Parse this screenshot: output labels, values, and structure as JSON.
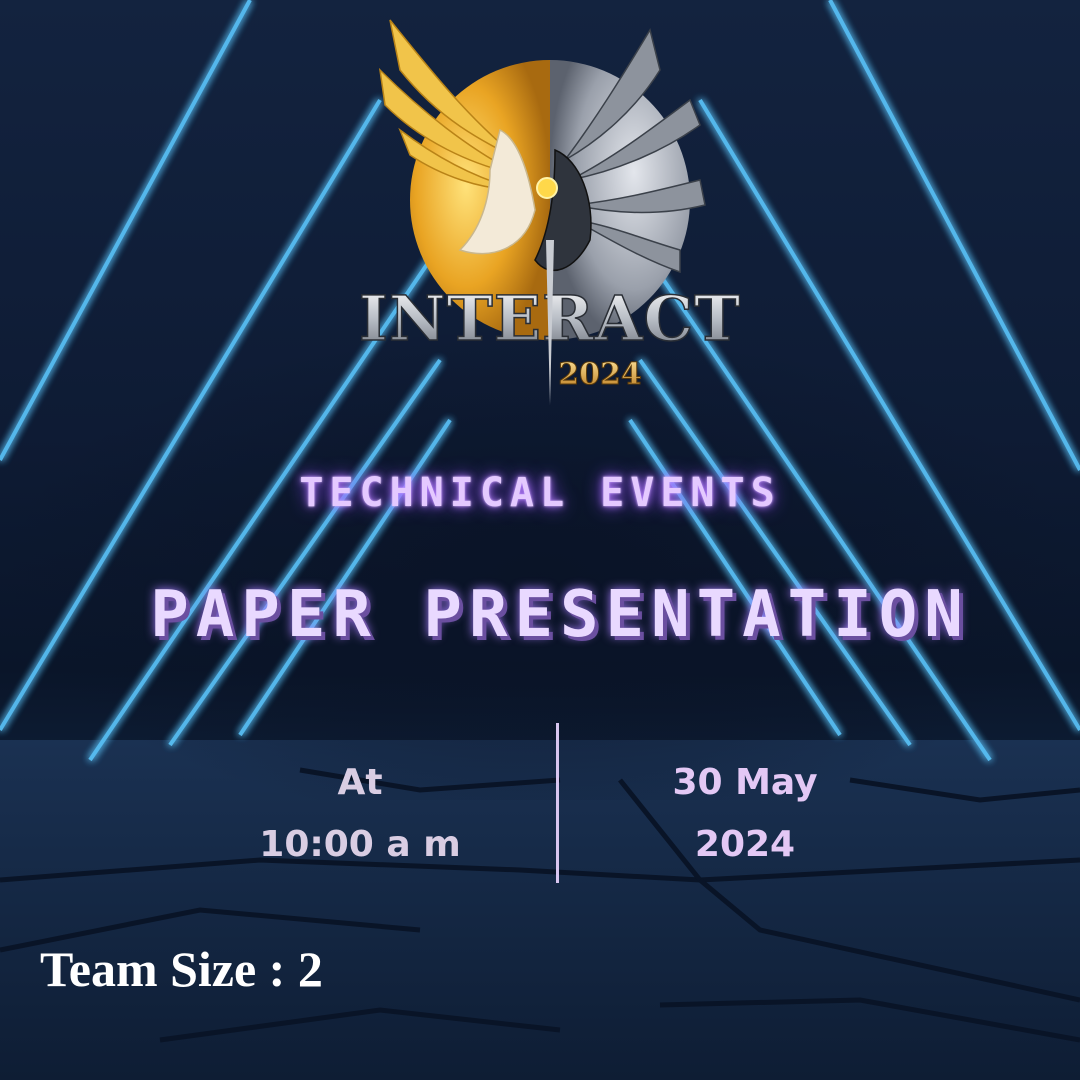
{
  "logo": {
    "name": "INTERACT",
    "year": "2024"
  },
  "event": {
    "category": "TECHNICAL EVENTS",
    "title": "PAPER PRESENTATION"
  },
  "schedule": {
    "time_prefix": "At",
    "time": "10:00 a m",
    "date_day_month": "30 May",
    "date_year": "2024"
  },
  "team": {
    "label": "Team Size : 2"
  },
  "colors": {
    "neon_blue": "#4fc3ff",
    "neon_purple": "#e4c9ff",
    "background": "#0c1a33"
  }
}
